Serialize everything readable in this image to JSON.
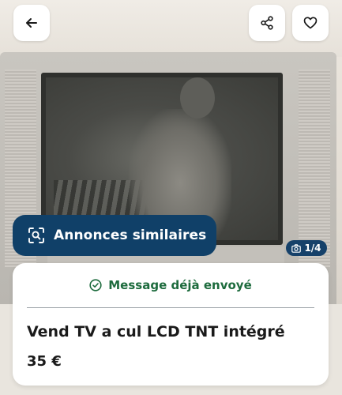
{
  "header": {
    "back_icon": "arrow-left-icon",
    "share_icon": "share-icon",
    "favorite_icon": "heart-icon"
  },
  "gallery": {
    "similar_ads_label": "Annonces similaires",
    "similar_ads_icon": "image-search-icon",
    "photo_counter": "1/4",
    "camera_icon": "camera-icon"
  },
  "listing": {
    "message_status": "Message déjà envoyé",
    "status_icon": "check-circle-icon",
    "title": "Vend TV a cul LCD TNT intégré",
    "price": "35 €"
  },
  "colors": {
    "primary": "#104068",
    "success": "#1d6b3d",
    "text": "#1a1a1a"
  }
}
